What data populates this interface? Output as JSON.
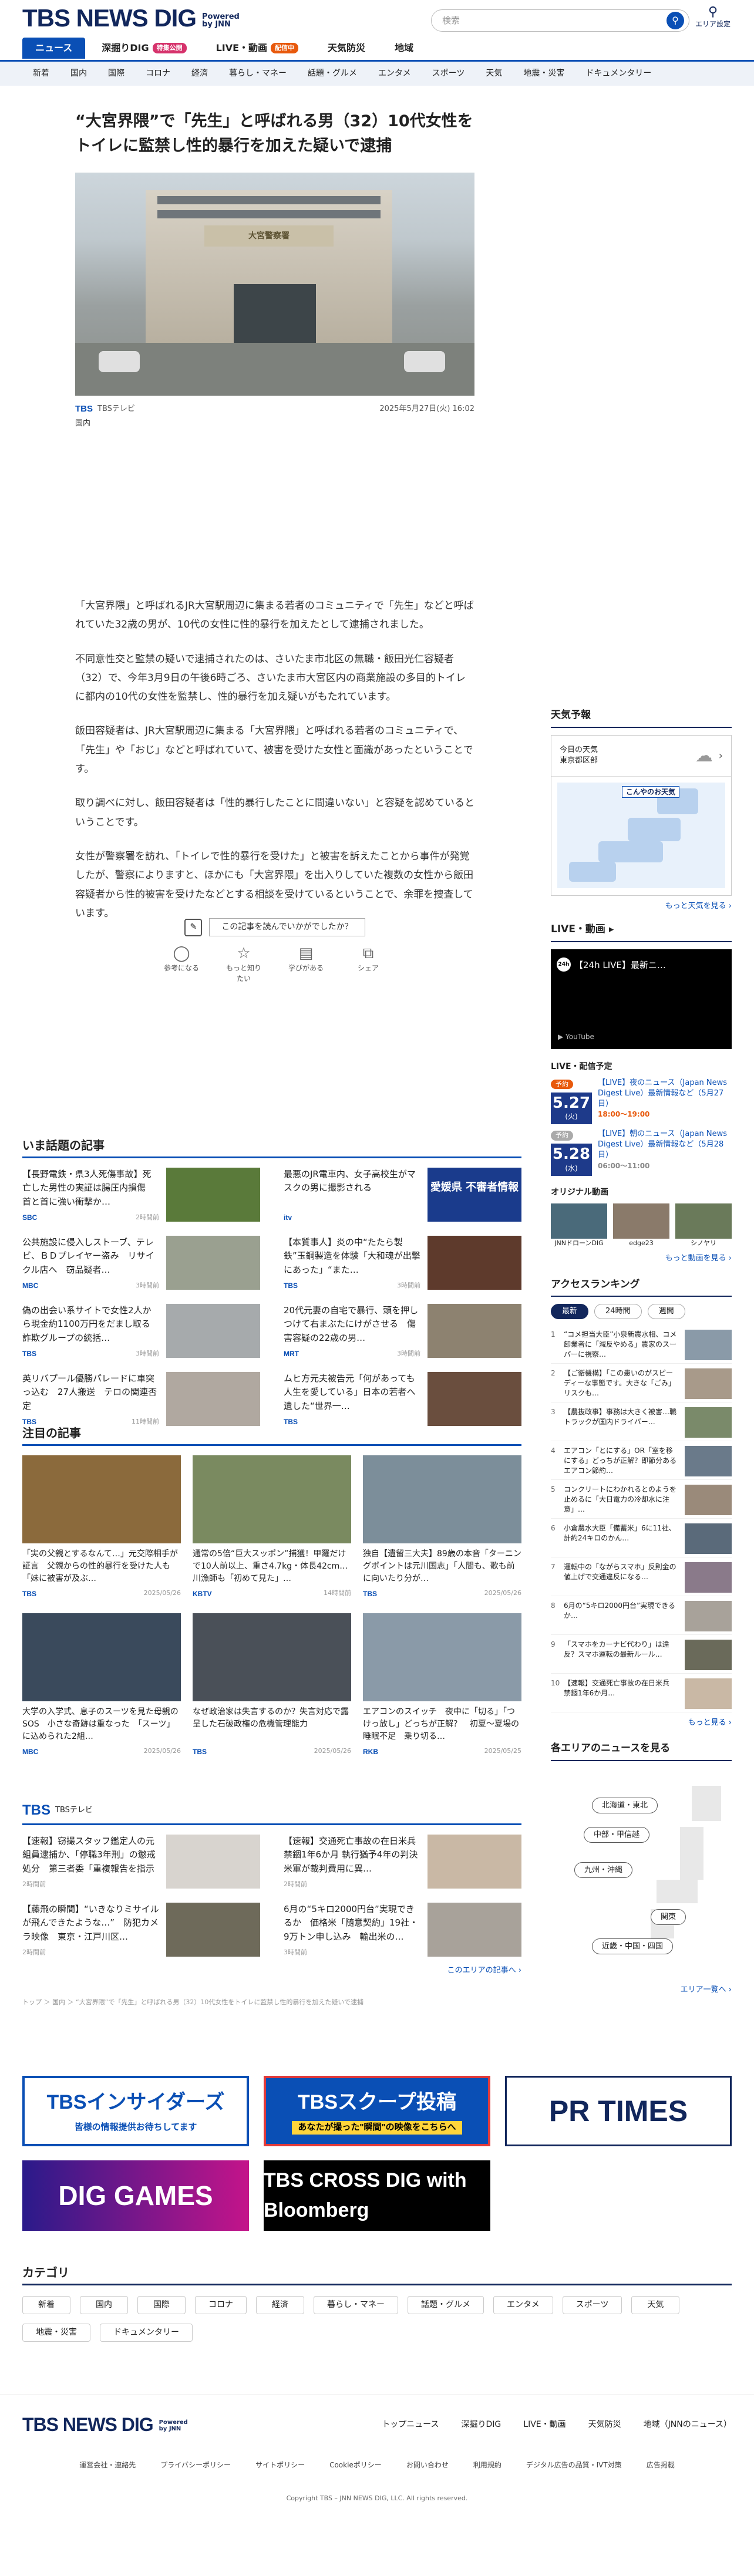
{
  "header": {
    "logo": "TBS NEWS DIG",
    "powered": "Powered by JNN",
    "search_placeholder": "検索",
    "area_label": "エリア設定"
  },
  "tabs": [
    {
      "label": "ニュース",
      "active": true
    },
    {
      "label": "深掘りDIG",
      "badge": "特集公開"
    },
    {
      "label": "LIVE・動画",
      "badge": "配信中"
    },
    {
      "label": "天気防災"
    },
    {
      "label": "地域"
    }
  ],
  "categories": [
    "新着",
    "国内",
    "国際",
    "コロナ",
    "経済",
    "暮らし・マネー",
    "話題・グルメ",
    "エンタメ",
    "スポーツ",
    "天気",
    "地震・災害",
    "ドキュメンタリー"
  ],
  "article": {
    "headline": "“大宮界隈”で「先生」と呼ばれる男（32）10代女性をトイレに監禁し性的暴行を加えた疑いで逮捕",
    "photo_sign": "大宮警察署",
    "source": "TBSテレビ",
    "date": "2025年5月27日(火) 16:02",
    "genre": "国内",
    "paragraphs": [
      "「大宮界隈」と呼ばれるJR大宮駅周辺に集まる若者のコミュニティで「先生」などと呼ばれていた32歳の男が、10代の女性に性的暴行を加えたとして逮捕されました。",
      "不同意性交と監禁の疑いで逮捕されたのは、さいたま市北区の無職・飯田光仁容疑者（32）で、今年3月9日の午後6時ごろ、さいたま市大宮区内の商業施設の多目的トイレに都内の10代の女性を監禁し、性的暴行を加え疑いがもたれています。",
      "飯田容疑者は、JR大宮駅周辺に集まる「大宮界隈」と呼ばれる若者のコミュニティで、「先生」や「おじ」などと呼ばれていて、被害を受けた女性と面識があったということです。",
      "取り調べに対し、飯田容疑者は「性的暴行したことに間違いない」と容疑を認めているということです。",
      "女性が警察署を訪れ、「トイレで性的暴行を受けた」と被害を訴えたことから事件が発覚したが、警察によりますと、ほかにも「大宮界隈」を出入りしていた複数の女性から飯田容疑者から性的被害を受けたなどとする相談を受けているということで、余罪を捜査しています。"
    ],
    "feedback_question": "この記事を読んでいかがでしたか？",
    "feedback_options": [
      "参考になる",
      "もっと知りたい",
      "学びがある",
      "シェア"
    ]
  },
  "trending": {
    "title": "いま話題の記事",
    "items": [
      {
        "title": "【長野電鉄・県3人死傷事故】死亡した男性の実証は腸圧内損傷　首と首に強い衝撃か…",
        "source": "SBC",
        "time": "2時間前",
        "color": "#5a7a3a"
      },
      {
        "title": "最悪のJR電車内、女子高校生がマスクの男に撮影される",
        "source": "itv",
        "time": "",
        "color": "#1a3b8c",
        "thumb_text": "愛媛県 不審者情報"
      },
      {
        "title": "公共施設に侵入しストーブ、テレビ、ＢＤプレイヤー盗み　リサイクル店へ　窃品疑者…",
        "source": "MBC",
        "time": "3時間前",
        "color": "#9aa090"
      },
      {
        "title": "【本質事人】炎の中“たたら製鉄”玉鋼製造を体験「大和魂が出撃にあった」“また…",
        "source": "TBS",
        "time": "3時間前",
        "color": "#5e3a2c"
      },
      {
        "title": "偽の出会い系サイトで女性2人から現金約1100万円をだまし取る　詐欺グループの統括…",
        "source": "TBS",
        "time": "3時間前",
        "color": "#a6aaac"
      },
      {
        "title": "20代元妻の自宅で暴行、頭を押しつけて右まぶたにけがさせる　傷害容疑の22歳の男…",
        "source": "MRT",
        "time": "3時間前",
        "color": "#8d8270"
      },
      {
        "title": "英リバプール優勝パレードに車突っ込む　27人搬送　テロの関連否定",
        "source": "TBS",
        "time": "11時間前",
        "color": "#b0a8a0"
      },
      {
        "title": "ムヒ方元夫被告元「何があっても人生を愛している」日本の若者へ遺した“世界一…",
        "source": "TBS",
        "time": "",
        "color": "#6a4e3e"
      }
    ]
  },
  "featured": {
    "title": "注目の記事",
    "items": [
      {
        "title": "「実の父親とするなんて…」元交際相手が証言　父親からの性的暴行を受けた人も「妹に被害が及ぶ…",
        "source": "TBS",
        "time": "2025/05/26",
        "color": "#8b6a3c"
      },
      {
        "title": "通常の5倍“巨大スッポン”捕獲！甲羅だけで10人前以上、重さ4.7kg・体長42cm…川漁師も「初めて見た」…",
        "source": "KBTV",
        "time": "14時間前",
        "color": "#7a8a60"
      },
      {
        "title": "独自【遺留三大夫】89歳の本音「ターニングポイントは元川国志」「人間も、歌も前に向いたり分が…",
        "source": "TBS",
        "time": "2025/05/26",
        "color": "#7c8e9a"
      },
      {
        "title": "大学の入学式、息子のスーツを見た母親のSOS　小さな奇跡は重なった　「スーツ」に込められた2組…",
        "source": "MBC",
        "time": "2025/05/26",
        "color": "#3a4a5c"
      },
      {
        "title": "なぜ政治家は失言するのか？失言対応で露呈した石破政権の危機管理能力",
        "source": "TBS",
        "time": "2025/05/26",
        "color": "#4a5058"
      },
      {
        "title": "エアコンのスイッチ　夜中に「切る」「つけっ放し」どっちが正解？　初夏〜夏場の睡眠不足　乗り切る…",
        "source": "RKB",
        "time": "2025/05/25",
        "color": "#8a9aa8"
      }
    ]
  },
  "tbs_section": {
    "title": "TBSテレビ",
    "items": [
      {
        "title": "【速報】窃撮スタッフ鑑定人の元組員逮捕か、「停職3年刑」の懲戒処分　第三者委「重複報告を指示を…",
        "time": "2時間前",
        "color": "#d8d4cf"
      },
      {
        "title": "【速報】交通死亡事故の在日米兵　禁錮1年6か月 執行猶予4年の判決　米軍が裁判費用に異…",
        "time": "2時間前",
        "color": "#c9b8a5"
      },
      {
        "title": "【藤飛の瞬間】“いきなりミサイルが飛んできたような…”　防犯カメラ映像　東京・江戸川区…",
        "time": "2時間前",
        "color": "#6e6a5a"
      },
      {
        "title": "6月の“5キロ2000円台”実現できるか　価格米「随意契約」19社・9万トン申し込み　輸出米の…",
        "time": "3時間前",
        "color": "#a8a29a"
      }
    ],
    "more": "このエリアの記事へ ›"
  },
  "breadcrumb": "トップ ＞ 国内 ＞ “大宮界隈”で「先生」と呼ばれる男（32）10代女性をトイレに監禁し性的暴行を加えた疑いで逮捕",
  "banners": [
    {
      "label": "TBSインサイダーズ",
      "sub": "皆様の情報提供お待ちしてます"
    },
    {
      "label": "TBSスクープ投稿",
      "sub": "あなたが撮った\"瞬間\"の映像をこちらへ"
    },
    {
      "label": "PR TIMES"
    },
    {
      "label": "DIG GAMES"
    },
    {
      "label": "TBS CROSS DIG with Bloomberg"
    }
  ],
  "category_section": {
    "title": "カテゴリ",
    "items": [
      "新着",
      "国内",
      "国際",
      "コロナ",
      "経済",
      "暮らし・マネー",
      "話題・グルメ",
      "エンタメ",
      "スポーツ",
      "天気",
      "地震・災害",
      "ドキュメンタリー"
    ]
  },
  "sidebar": {
    "weather": {
      "title": "天気予報",
      "today_label": "今日の天気",
      "location": "東京都区部",
      "map_label": "こんやのお天気",
      "more": "もっと天気を見る ›"
    },
    "live": {
      "title": "LIVE・動画 ▸",
      "player_title": "【24h LIVE】最新ニ…",
      "schedule_title": "LIVE・配信予定",
      "schedule": [
        {
          "tag": "予約",
          "date_label": "2025/05/27",
          "day": "5.27",
          "weekday": "(火)",
          "title": "【LIVE】夜のニュース（Japan News Digest Live）最新情報など（5月27日）",
          "time": "18:00～19:00",
          "gray": false
        },
        {
          "tag": "予約",
          "date_label": "2025/05/28",
          "day": "5.28",
          "weekday": "(水)",
          "title": "【LIVE】朝のニュース（Japan News Digest Live）最新情報など（5月28日）",
          "time": "06:00～11:00",
          "gray": true
        }
      ],
      "original_title": "オリジナル動画",
      "original": [
        "JNNドローンDIG",
        "edge23",
        "シノヤリ"
      ],
      "more": "もっと動画を見る ›"
    },
    "ranking": {
      "title": "アクセスランキング",
      "tabs": [
        "最新",
        "24時間",
        "週間"
      ],
      "items": [
        "“コメ担当大臣”小泉新農水相、コメ卸業者に「減反やめる」農家のスーパーに視察…",
        "【ご衛機構】「この患いのがスピーディーな事態です。大きな「ごみ」リスクも…",
        "【農抜政事】事務は大きく被害…職トラックが国内ドライバー…",
        "エアコン「とにする」OR「室を移にする」どっちが正解？即節分あるエアコン節約…",
        "コンクリートにわかれるとのようを止めるに「大日電力の冷却水に注意」…",
        "小倉農水大臣「備蓄米」6に11社、計約24キロのかん…",
        "運転中の「ながらスマホ」反則金の値上げで交通違反になる…",
        "6月の“5キロ2000円台”実現できるか…",
        "「スマホをカーナビ代わり」は違反？スマホ運転の最新ルール…",
        "【速報】交通死亡事故の在日米兵　禁錮1年6か月…"
      ],
      "more": "もっと見る ›"
    },
    "area": {
      "title": "各エリアのニュースを見る",
      "regions": [
        "北海道・東北",
        "中部・甲信越",
        "九州・沖縄",
        "関東",
        "近畿・中国・四国"
      ],
      "more": "エリア一覧へ ›"
    }
  },
  "footer": {
    "logo": "TBS NEWS DIG",
    "links": [
      "トップニュース",
      "深掘りDIG",
      "LIVE・動画",
      "天気防災",
      "地域（JNNのニュース）"
    ],
    "sub_links": [
      "運営会社・連絡先",
      "プライバシーポリシー",
      "サイトポリシー",
      "Cookieポリシー",
      "お問い合わせ",
      "利用規約",
      "デジタル広告の品質・IVT対策",
      "広告掲載"
    ],
    "copyright": "Copyright TBS – JNN NEWS DIG, LLC. All rights reserved."
  },
  "colors": {
    "brand": "#12275c",
    "accent": "#0a4fb5",
    "badge_pink": "#d6336c",
    "live_orange": "#e8590c"
  }
}
